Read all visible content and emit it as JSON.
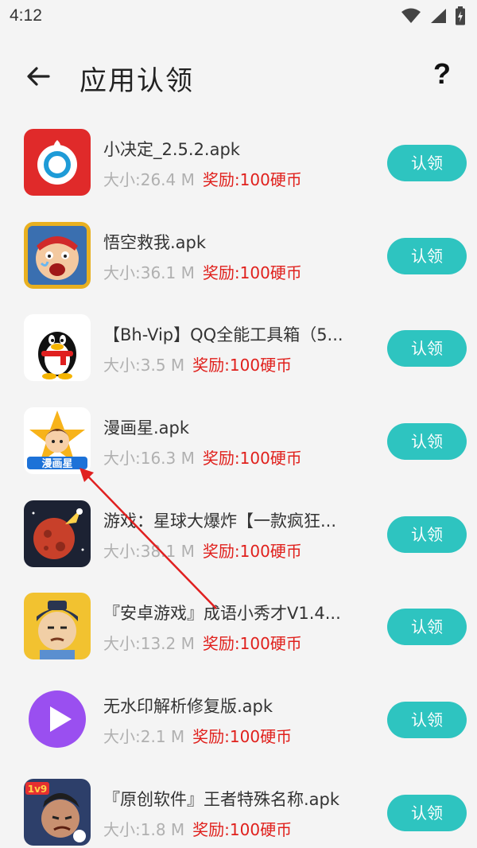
{
  "status_bar": {
    "time": "4:12"
  },
  "header": {
    "title": "应用认领",
    "help": "?"
  },
  "items": [
    {
      "name": "小决定_2.5.2.apk",
      "size": "大小:26.4 M",
      "reward": "奖励:100硬币",
      "button": "认领",
      "icon": "xiaojueding-app-icon"
    },
    {
      "name": "悟空救我.apk",
      "size": "大小:36.1 M",
      "reward": "奖励:100硬币",
      "button": "认领",
      "icon": "wukong-app-icon"
    },
    {
      "name": "【Bh-Vip】QQ全能工具箱（5...",
      "size": "大小:3.5 M",
      "reward": "奖励:100硬币",
      "button": "认领",
      "icon": "qq-penguin-icon"
    },
    {
      "name": "漫画星.apk",
      "size": "大小:16.3 M",
      "reward": "奖励:100硬币",
      "button": "认领",
      "icon": "manhuaxing-app-icon"
    },
    {
      "name": "游戏：星球大爆炸【一款疯狂...",
      "size": "大小:38.1 M",
      "reward": "奖励:100硬币",
      "button": "认领",
      "icon": "planet-explosion-icon"
    },
    {
      "name": "『安卓游戏』成语小秀才V1.4...",
      "size": "大小:13.2 M",
      "reward": "奖励:100硬币",
      "button": "认领",
      "icon": "scholar-game-icon"
    },
    {
      "name": "无水印解析修复版.apk",
      "size": "大小:2.1 M",
      "reward": "奖励:100硬币",
      "button": "认领",
      "icon": "play-video-icon"
    },
    {
      "name": "『原创软件』王者特殊名称.apk",
      "size": "大小:1.8 M",
      "reward": "奖励:100硬币",
      "button": "认领",
      "icon": "honor-of-kings-icon"
    }
  ],
  "colors": {
    "accent": "#2ec4c0",
    "reward": "#e0201c",
    "background": "#f4f4f4"
  }
}
